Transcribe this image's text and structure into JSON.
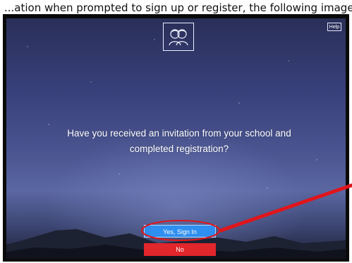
{
  "caption": {
    "text": "...ation when prompted to sign up or register, the following image will"
  },
  "screen": {
    "logo_icon": "two-people-icon",
    "help_label": "Help",
    "question": "Have you received an invitation from your school and completed registration?",
    "yes_label": "Yes, Sign In",
    "no_label": "No"
  },
  "colors": {
    "yes_button": "#2f8ff0",
    "no_button": "#e1262c",
    "annotation": "#e0151b"
  }
}
